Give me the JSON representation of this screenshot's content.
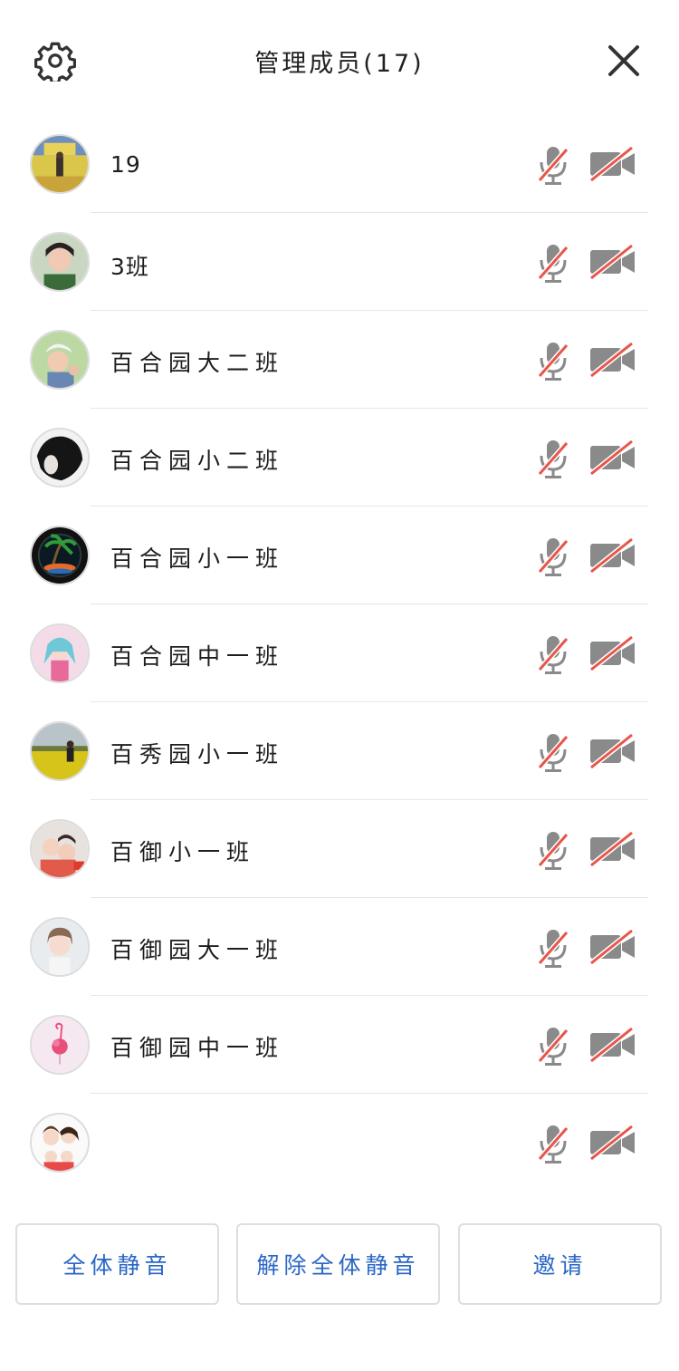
{
  "header": {
    "title": "管理成员(17)",
    "settings_icon": "gear-icon",
    "close_icon": "close-icon"
  },
  "colors": {
    "icon_gray": "#8a8a8a",
    "slash_red": "#e8554a",
    "button_blue": "#2a66c6",
    "divider": "#e6e6e6"
  },
  "members": [
    {
      "name": "19",
      "mic": "muted",
      "camera": "off"
    },
    {
      "name": "3班",
      "mic": "muted",
      "camera": "off"
    },
    {
      "name": "百合园大二班",
      "mic": "muted",
      "camera": "off"
    },
    {
      "name": "百合园小二班",
      "mic": "muted",
      "camera": "off"
    },
    {
      "name": "百合园小一班",
      "mic": "muted",
      "camera": "off"
    },
    {
      "name": "百合园中一班",
      "mic": "muted",
      "camera": "off"
    },
    {
      "name": "百秀园小一班",
      "mic": "muted",
      "camera": "off"
    },
    {
      "name": "百御小一班",
      "mic": "muted",
      "camera": "off"
    },
    {
      "name": "百御园大一班",
      "mic": "muted",
      "camera": "off"
    },
    {
      "name": "百御园中一班",
      "mic": "muted",
      "camera": "off"
    },
    {
      "name": "",
      "mic": "muted",
      "camera": "off"
    }
  ],
  "actions": {
    "mute_all": "全体静音",
    "unmute_all": "解除全体静音",
    "invite": "邀请"
  }
}
